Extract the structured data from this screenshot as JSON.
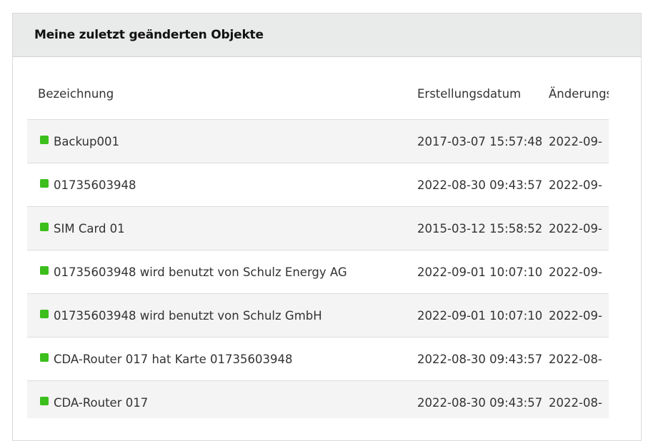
{
  "panel": {
    "title": "Meine zuletzt geänderten Objekte"
  },
  "table": {
    "columns": [
      "Bezeichnung",
      "Erstellungsdatum",
      "Änderungsdatum"
    ],
    "rows": [
      {
        "status": "ok",
        "name": "Backup001",
        "created": "2017-03-07 15:57:48",
        "modified": "2022-09-"
      },
      {
        "status": "ok",
        "name": "01735603948",
        "created": "2022-08-30 09:43:57",
        "modified": "2022-09-"
      },
      {
        "status": "ok",
        "name": "SIM Card 01",
        "created": "2015-03-12 15:58:52",
        "modified": "2022-09-"
      },
      {
        "status": "ok",
        "name": "01735603948 wird benutzt von Schulz Energy AG",
        "created": "2022-09-01 10:07:10",
        "modified": "2022-09-"
      },
      {
        "status": "ok",
        "name": "01735603948 wird benutzt von Schulz GmbH",
        "created": "2022-09-01 10:07:10",
        "modified": "2022-09-"
      },
      {
        "status": "ok",
        "name": "CDA-Router 017 hat Karte 01735603948",
        "created": "2022-08-30 09:43:57",
        "modified": "2022-08-"
      },
      {
        "status": "ok",
        "name": "CDA-Router 017",
        "created": "2022-08-30 09:43:57",
        "modified": "2022-08-"
      }
    ]
  },
  "colors": {
    "status_ok": "#3cbf1c",
    "header_bg": "#e9eaea",
    "row_alt_bg": "#f4f4f4"
  },
  "icons": {
    "status": "green-square-status-icon"
  }
}
